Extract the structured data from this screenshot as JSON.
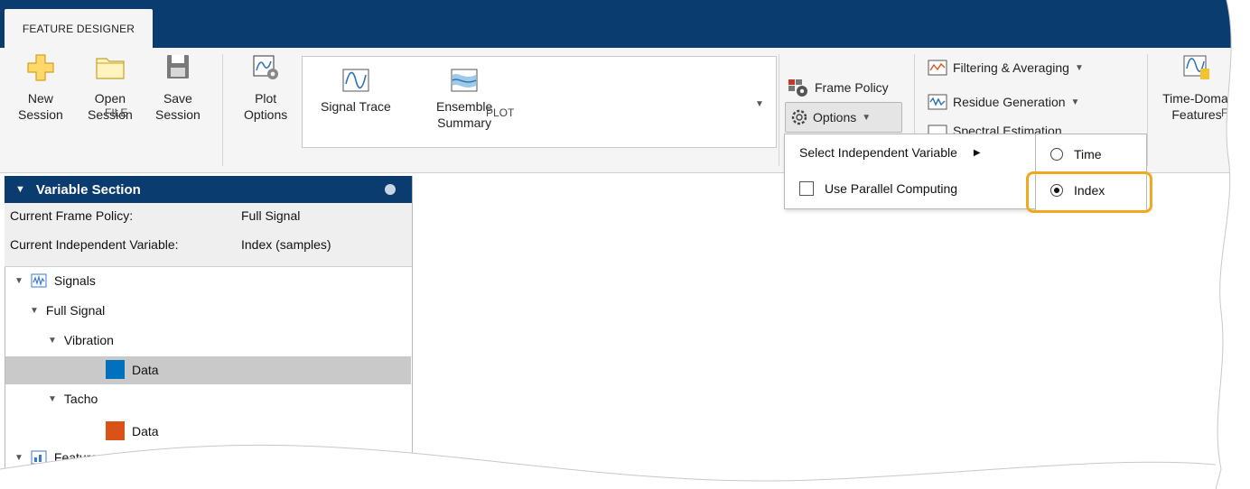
{
  "app": {
    "tab_label": "FEATURE DESIGNER"
  },
  "toolbar": {
    "new_session": "New\nSession",
    "open_session": "Open\nSession",
    "save_session": "Save\nSession",
    "file_section": "FILE",
    "plot_options": "Plot\nOptions",
    "plot_section": "PLOT",
    "gallery": {
      "signal_trace": "Signal Trace",
      "ensemble_summary": "Ensemble\nSummary"
    },
    "frame_policy": "Frame Policy",
    "options": "Options",
    "filtering_averaging": "Filtering & Averaging",
    "residue_generation": "Residue Generation",
    "spectral_estimation": "Spectral Estimation",
    "time_domain_features": "Time-Domai\nFeatures",
    "feature_section": "FEAT"
  },
  "menu": {
    "select_independent_variable": "Select Independent Variable",
    "use_parallel_computing": "Use Parallel Computing",
    "submenu": {
      "time": "Time",
      "index": "Index",
      "selected": "Index"
    }
  },
  "panel": {
    "title": "Variable Section",
    "frame_policy_label": "Current Frame Policy:",
    "frame_policy_value": "Full Signal",
    "indep_var_label": "Current Independent Variable:",
    "indep_var_value": "Index (samples)"
  },
  "tree": {
    "signals": "Signals",
    "full_signal": "Full Signal",
    "vibration": "Vibration",
    "vibration_data": "Data",
    "tacho": "Tacho",
    "tacho_data": "Data",
    "features": "Features"
  },
  "colors": {
    "accent": "#0b3c6f",
    "highlight": "#f0a820",
    "vibration": "#0072bd",
    "tacho": "#d95319"
  }
}
